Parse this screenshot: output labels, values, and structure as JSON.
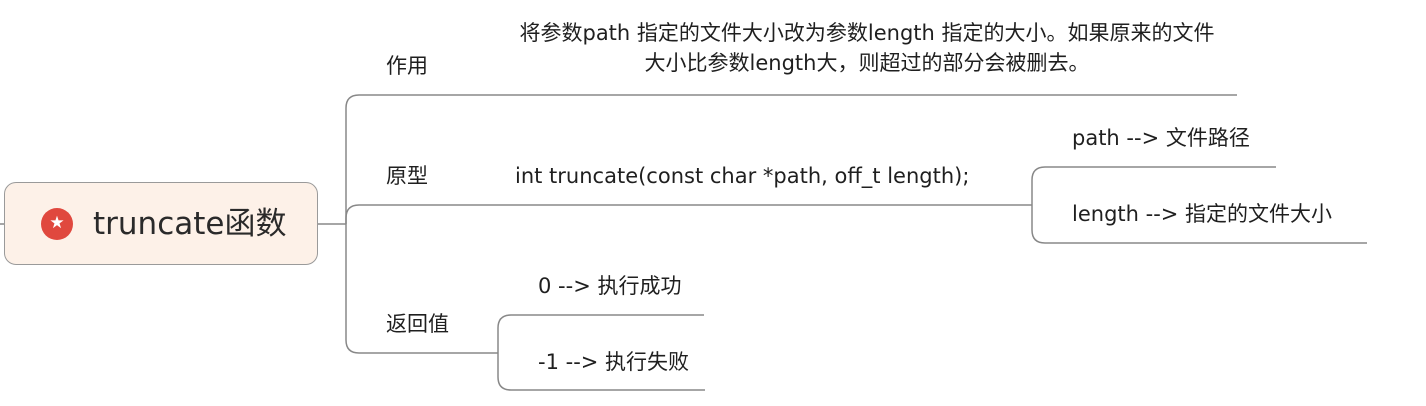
{
  "root": {
    "title": "truncate函数",
    "icon": "star-icon",
    "icon_color": "#e0483e"
  },
  "branches": {
    "purpose": {
      "label": "作用",
      "description": "将参数path 指定的文件大小改为参数length 指定的大小。如果原来的文件大小比参数length大，则超过的部分会被删去。"
    },
    "prototype": {
      "label": "原型",
      "signature": "int truncate(const char *path, off_t length);",
      "params": [
        "path --> 文件路径",
        "length --> 指定的文件大小"
      ]
    },
    "return_value": {
      "label": "返回值",
      "items": [
        "0 --> 执行成功",
        "-1 --> 执行失败"
      ]
    }
  },
  "colors": {
    "root_fill": "#fdf1e8",
    "line": "#888888"
  }
}
